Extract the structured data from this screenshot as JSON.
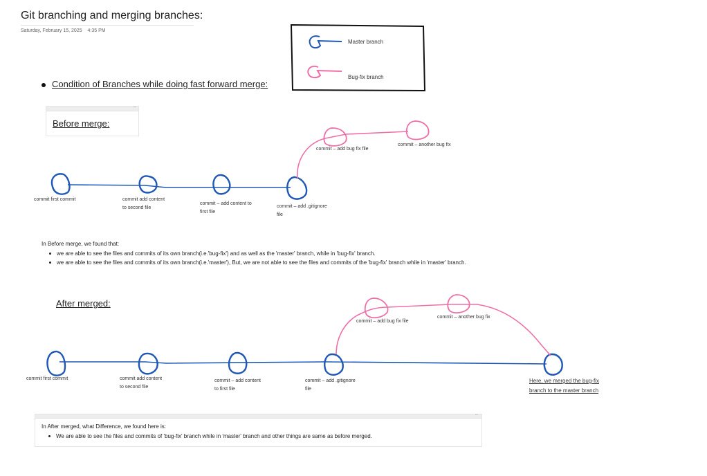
{
  "page": {
    "title": "Git branching and merging branches:",
    "date": "Saturday, February 15, 2025",
    "time": "4:35 PM"
  },
  "legend": {
    "master": "Master branch",
    "bugfix": "Bug-fix branch",
    "master_color": "#1f57b5",
    "bugfix_color": "#ee6fa8"
  },
  "section_heading": "Condition of Branches while doing fast forward merge:",
  "before": {
    "heading": "Before merge:",
    "master_commits": [
      {
        "line1": "commit   first commit",
        "line2": ""
      },
      {
        "line1": "commit   add content",
        "line2": "to second file"
      },
      {
        "line1": "commit – add content to",
        "line2": "first file"
      },
      {
        "line1": "commit – add .gitignore",
        "line2": "file"
      }
    ],
    "bugfix_commits": [
      {
        "label": "commit – add bug fix file"
      },
      {
        "label": "commit – another bug fix"
      }
    ],
    "notes": {
      "title": "In Before merge, we found that:",
      "items": [
        "we are able to see the files and commits of its own branch(i.e.'bug-fix') and as well as the 'master' branch, while in 'bug-fix' branch.",
        "we are able to see the files and commits of its own branch(i.e.'master'), But, we are not able to see the files and commits of the 'bug-fix' branch while in 'master' branch."
      ]
    }
  },
  "after": {
    "heading": "After merged:",
    "master_commits": [
      {
        "line1": "commit   first commit",
        "line2": ""
      },
      {
        "line1": "commit   add content",
        "line2": "to second file"
      },
      {
        "line1": "commit – add content",
        "line2": "to first file"
      },
      {
        "line1": "commit – add .gitignore",
        "line2": "file"
      }
    ],
    "bugfix_commits": [
      {
        "label": "commit – add bug fix file"
      },
      {
        "label": "commit – another bug fix"
      }
    ],
    "merge_note": {
      "line1": "Here, we merged the bug-fix",
      "line2": "branch to the master branch"
    },
    "notes": {
      "title": "In After merged, what Difference, we found here is:",
      "items": [
        "We are able to see the files and commits of 'bug-fix' branch while in 'master' branch and other things are same as before merged."
      ]
    }
  }
}
